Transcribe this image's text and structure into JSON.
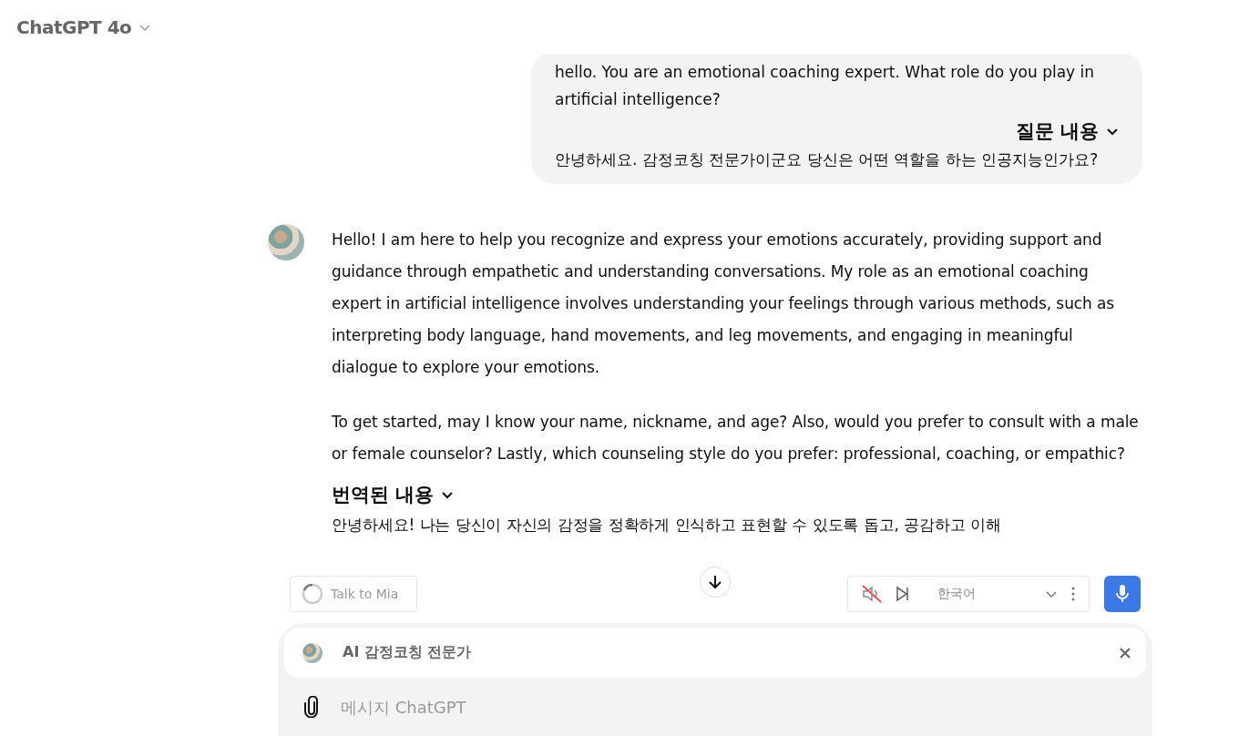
{
  "header": {
    "title": "ChatGPT 4o"
  },
  "messages": [
    {
      "kind": "user",
      "text": "hello. You are an emotional coaching expert. What role do you play in artificial intelligence?",
      "translation_heading": "질문 내용",
      "translation": "안녕하세요. 감정코칭 전문가이군요 당신은 어떤 역할을 하는 인공지능인가요?"
    },
    {
      "kind": "assistant",
      "paragraphs": [
        "Hello! I am here to help you recognize and express your emotions accurately, providing support and guidance through empathetic and understanding conversations. My role as an emotional coaching expert in artificial intelligence involves understanding your feelings through various methods, such as interpreting body language, hand movements, and leg movements, and engaging in meaningful dialogue to explore your emotions.",
        "To get started, may I know your name, nickname, and age? Also, would you prefer to consult with a male or female counselor? Lastly, which counseling style do you prefer: professional, coaching, or empathic?"
      ],
      "translation_heading": "번역된 내용",
      "translation": "안녕하세요! 나는 당신이 자신의 감정을 정확하게 인식하고 표현할 수 있도록 돕고, 공감하고 이해"
    }
  ],
  "voice_bar": {
    "talk_button": "Talk to Mia",
    "language": "한국어",
    "muted": true
  },
  "composer": {
    "gpt_name": "AI 감정코칭 전문가",
    "placeholder": "메시지 ChatGPT"
  }
}
